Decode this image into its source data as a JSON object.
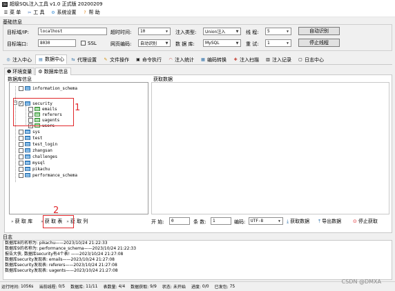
{
  "window": {
    "title": "超级SQL注入工具 v1.0 正式版 20200209"
  },
  "menu": {
    "items": [
      {
        "label": "菜 单",
        "icon": "menu-icon"
      },
      {
        "label": "工 具",
        "icon": "tools-icon"
      },
      {
        "label": "系统设置",
        "icon": "settings-icon"
      },
      {
        "label": "帮 助",
        "icon": "help-icon"
      }
    ]
  },
  "basic": {
    "group_title": "基础信息",
    "target_host_label": "目标域/IP:",
    "target_host_value": "localhost",
    "target_port_label": "目标端口:",
    "target_port_value": "8030",
    "ssl_label": "SSL",
    "timeout_label": "超时时间:",
    "timeout_value": "10",
    "page_encoding_label": "网页编码:",
    "page_encoding_value": "自动识别",
    "inject_type_label": "注入类型:",
    "inject_type_value": "Union注入",
    "database_label": "数 据 库:",
    "database_value": "MySQL",
    "threads_label": "线 程:",
    "threads_value": "5",
    "retry_label": "重 试:",
    "retry_value": "1",
    "auto_detect_button": "自动识别",
    "stop_threads_button": "停止线程"
  },
  "tabs": [
    {
      "label": "注入中心",
      "icon": "target-icon",
      "active": false
    },
    {
      "label": "数据中心",
      "icon": "database-icon",
      "active": true
    },
    {
      "label": "代理设置",
      "icon": "proxy-icon",
      "active": false
    },
    {
      "label": "文件操作",
      "icon": "file-icon",
      "active": false
    },
    {
      "label": "命令执行",
      "icon": "terminal-icon",
      "active": false
    },
    {
      "label": "注入统计",
      "icon": "stats-icon",
      "active": false
    },
    {
      "label": "编码转换",
      "icon": "encode-icon",
      "active": false
    },
    {
      "label": "注入扫描",
      "icon": "scan-icon",
      "active": false
    },
    {
      "label": "注入记录",
      "icon": "record-icon",
      "active": false
    },
    {
      "label": "日志中心",
      "icon": "log-icon",
      "active": false
    }
  ],
  "subtabs": [
    {
      "label": "环境变量",
      "active": false
    },
    {
      "label": "数据库信息",
      "active": true
    }
  ],
  "db_panel": {
    "title": "数据库信息",
    "databases": [
      {
        "name": "information_schema",
        "checked": false
      },
      {
        "name": "security",
        "checked": true,
        "expanded": true,
        "tables": [
          {
            "name": "emails",
            "checked": false
          },
          {
            "name": "referers",
            "checked": false
          },
          {
            "name": "uagents",
            "checked": false
          },
          {
            "name": "users",
            "checked": true
          }
        ]
      },
      {
        "name": "sys",
        "checked": false
      },
      {
        "name": "test",
        "checked": false
      },
      {
        "name": "test_login",
        "checked": false
      },
      {
        "name": "zhangsan",
        "checked": false
      },
      {
        "name": "challenges",
        "checked": false
      },
      {
        "name": "mysql",
        "checked": false
      },
      {
        "name": "pikachu",
        "checked": false
      },
      {
        "name": "performance_schema",
        "checked": false
      }
    ]
  },
  "data_panel": {
    "title": "获取数据"
  },
  "actions": {
    "get_db": "获 取 库",
    "get_table": "获 取 表",
    "get_column": "获 取 列",
    "start_label": "开 始:",
    "start_value": "0",
    "count_label": "条 数:",
    "count_value": "1",
    "encoding_label": "编码:",
    "encoding_value": "UTF-8",
    "fetch_button": "获取数据",
    "export_button": "导出数据",
    "stop_button": "停止获取"
  },
  "annotations": {
    "box1_number": "1",
    "box2_number": "2"
  },
  "log": {
    "title": "日志",
    "lines": [
      "数据库8的名称为: pikachu——2023/10/24 21:22:33",
      "数据库9的名称为: performance_schema——2023/10/24 21:22:33",
      "报告大侠, 数据库security有4个表! ——2023/10/24 21:27:08",
      "数据库security发现表: emails——2023/10/24 21:27:08",
      "数据库security发现表: referers——2023/10/24 21:27:08",
      "数据库security发现表: uagents——2023/10/24 21:27:08"
    ]
  },
  "status": {
    "run_time_label": "运行时间:",
    "run_time_value": "1056s",
    "threads_label": "当前线程:",
    "threads_value": "0/5",
    "db_label": "数据库:",
    "db_value": "11/11",
    "tables_label": "表数量:",
    "tables_value": "4/4",
    "data_label": "数据获取:",
    "data_value": "9/9",
    "state_label": "状态:",
    "state_value": "未开始",
    "progress_label": "进度:",
    "progress_value": "0/0",
    "sent_label": "已发包:",
    "sent_value": "75"
  },
  "watermark": "CSDN @DMXA",
  "colors": {
    "annotation_red": "#e0262a",
    "accent_blue": "#2d6fa8"
  }
}
